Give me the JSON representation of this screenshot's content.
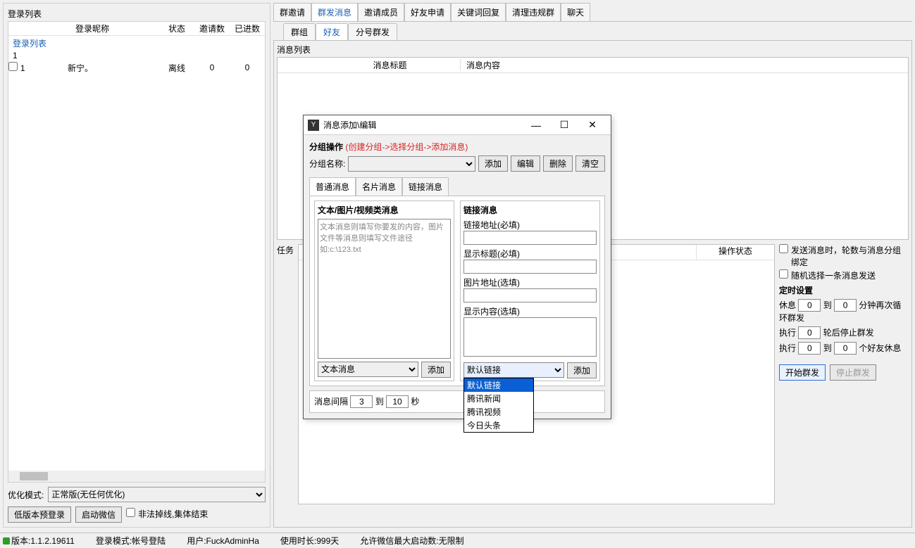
{
  "left": {
    "title": "登录列表",
    "headers": {
      "nickname": "登录昵称",
      "status": "状态",
      "invites": "邀请数",
      "entered": "已进数"
    },
    "group_label": "登录列表",
    "group_count": "1",
    "rows": [
      {
        "idx": "1",
        "nick": "新宁。",
        "status": "离线",
        "invites": "0",
        "entered": "0"
      }
    ],
    "optim_label": "优化模式:",
    "optim_value": "正常版(无任何优化)",
    "btn_low_login": "低版本预登录",
    "btn_start_wx": "启动微信",
    "chk_illegal_drop": "非法掉线,集体结束"
  },
  "top_tabs": [
    "群邀请",
    "群发消息",
    "邀请成员",
    "好友申请",
    "关键词回复",
    "清理违规群",
    "聊天"
  ],
  "sub_tabs": [
    "群组",
    "好友",
    "分号群发"
  ],
  "msg_list": {
    "title": "消息列表",
    "col_title": "消息标题",
    "col_content": "消息内容"
  },
  "task_label": "任务",
  "ops_title": "操作状态",
  "opts": {
    "chk_bind": "发送消息时，轮数与消息分组绑定",
    "chk_random": "随机选择一条消息发送",
    "timer_title": "定时设置",
    "rest": "休息",
    "to": "到",
    "minute_again": "分钟再次循环群发",
    "exec": "执行",
    "rounds_stop": "轮后停止群发",
    "friends_rest": "个好友休息",
    "val_rest_a": "0",
    "val_rest_b": "0",
    "val_exec_rounds": "0",
    "val_exec_a": "0",
    "val_exec_b": "0",
    "btn_start": "开始群发",
    "btn_stop": "停止群发"
  },
  "dialog": {
    "title": "消息添加\\编辑",
    "group_ops": "分组操作",
    "group_ops_hint": "(创建分组->选择分组->添加消息)",
    "group_name": "分组名称:",
    "btn_add": "添加",
    "btn_edit": "编辑",
    "btn_del": "删除",
    "btn_clear": "清空",
    "msg_tabs": [
      "普通消息",
      "名片消息",
      "链接消息"
    ],
    "left_section": "文本/图片/视频类消息",
    "placeholder": "文本消息则填写你要发的内容，图片文件等消息则填写文件途径如:c:\\123.txt",
    "text_type": "文本消息",
    "text_add": "添加",
    "right_section": "链接消息",
    "link_url": "链接地址(必填)",
    "link_title": "显示标题(必填)",
    "link_img": "图片地址(选填)",
    "link_content": "显示内容(选填)",
    "link_default": "默认链接",
    "link_add": "添加",
    "link_options": [
      "默认链接",
      "腾讯新闻",
      "腾讯视频",
      "今日头条"
    ],
    "interval_label": "消息间隔",
    "interval_a": "3",
    "interval_b": "10",
    "interval_unit": "秒"
  },
  "status": {
    "version": "版本:1.1.2.19611",
    "login_mode": "登录模式:帐号登陆",
    "user": "用户:FuckAdminHa",
    "use_time": "使用时长:999天",
    "max_start": "允许微信最大启动数:无限制"
  }
}
